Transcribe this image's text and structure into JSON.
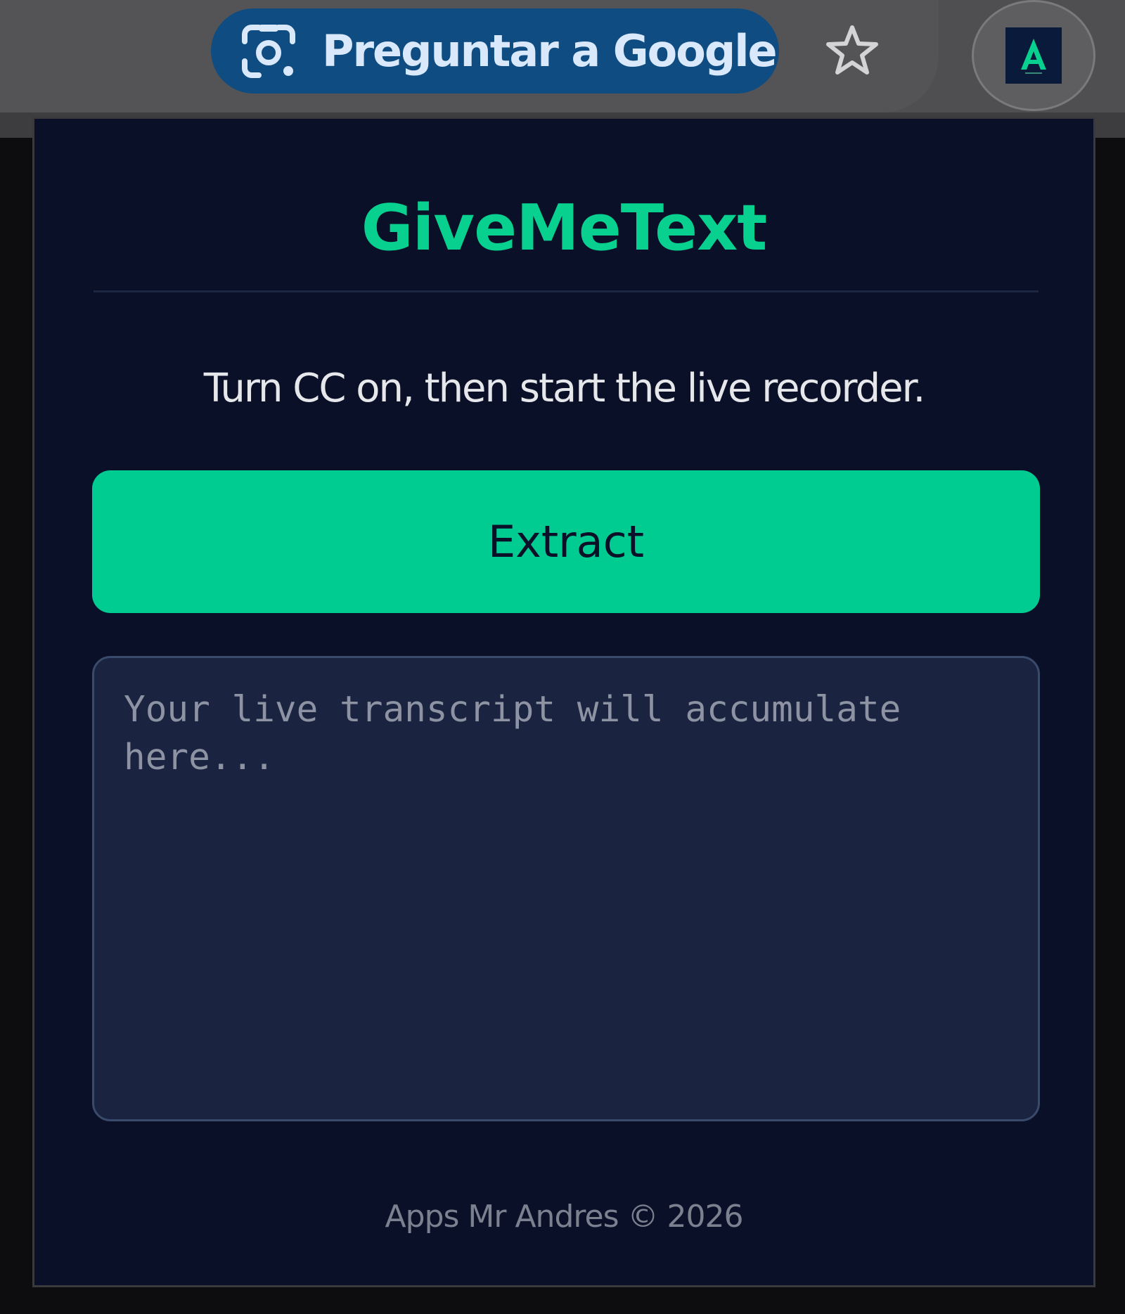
{
  "browser_toolbar": {
    "ask_google_label": "Preguntar a Google",
    "lens_icon": "google-lens-icon",
    "star_icon": "bookmark-star-icon",
    "extension_icon": "givemetext-extension-icon",
    "pill_color": "#0f4c81"
  },
  "popup": {
    "title": "GiveMeText",
    "instructions": "Turn CC on, then start the live recorder.",
    "extract_label": "Extract",
    "transcript": {
      "value": "",
      "placeholder": "Your live transcript will accumulate here..."
    },
    "footer": "Apps Mr Andres © 2026",
    "accent_color": "#00cc92",
    "background_color": "#0a1028"
  }
}
